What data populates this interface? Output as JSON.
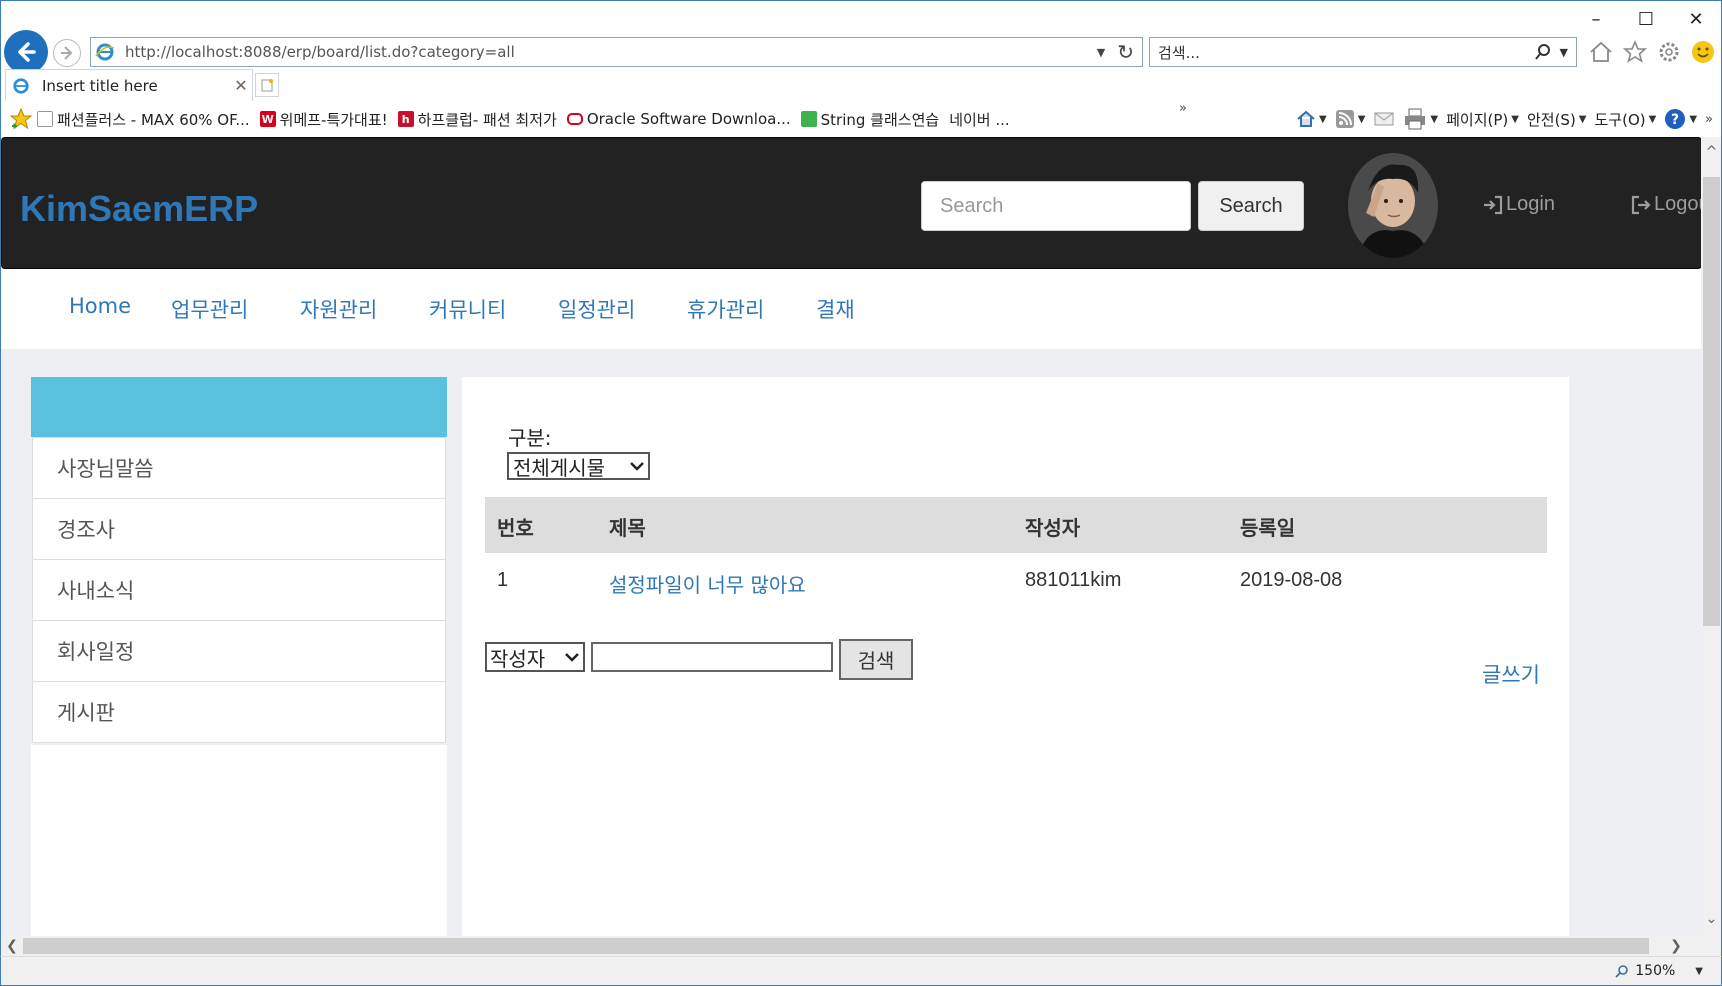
{
  "browser": {
    "address_url": "http://localhost:8088/erp/board/list.do?category=all",
    "search_placeholder": "검색...",
    "tab_title": "Insert title here",
    "favorites": [
      {
        "label": "패션플러스 - MAX 60% OF...",
        "color": "#ffffff"
      },
      {
        "label": "위메프-특가대표!",
        "color": "#d6001c"
      },
      {
        "label": "하프클럽- 패션 최저가",
        "color": "#d6001c"
      },
      {
        "label": "Oracle Software Downloa...",
        "color": "#d6001c"
      },
      {
        "label": "String 클래스연습",
        "color": "#3cb44b"
      },
      {
        "label": "네이버 ...",
        "color": ""
      }
    ],
    "commands": {
      "page": "페이지(P)",
      "safety": "안전(S)",
      "tools": "도구(O)"
    },
    "zoom": "150%"
  },
  "app": {
    "brand": "KimSaemERP",
    "search_placeholder": "Search",
    "search_button": "Search",
    "login": "Login",
    "logout": "Logout",
    "accent_color": "#2f78b8",
    "sidebar_head_color": "#5bc0de"
  },
  "menu": [
    {
      "label": "Home"
    },
    {
      "label": "업무관리"
    },
    {
      "label": "자원관리"
    },
    {
      "label": "커뮤니티"
    },
    {
      "label": "일정관리"
    },
    {
      "label": "휴가관리"
    },
    {
      "label": "결재"
    }
  ],
  "sidebar": {
    "items": [
      {
        "label": "사장님말씀"
      },
      {
        "label": "경조사"
      },
      {
        "label": "사내소식"
      },
      {
        "label": "회사일정"
      },
      {
        "label": "게시판"
      }
    ]
  },
  "board": {
    "category_label": "구분:",
    "category_selected": "전체게시물",
    "columns": [
      "번호",
      "제목",
      "작성자",
      "등록일"
    ],
    "rows": [
      {
        "no": "1",
        "title": "설정파일이 너무 많아요",
        "writer": "881011kim",
        "date": "2019-08-08"
      }
    ],
    "filter_selected": "작성자",
    "filter_value": "",
    "search_button": "검색",
    "write_link": "글쓰기"
  }
}
